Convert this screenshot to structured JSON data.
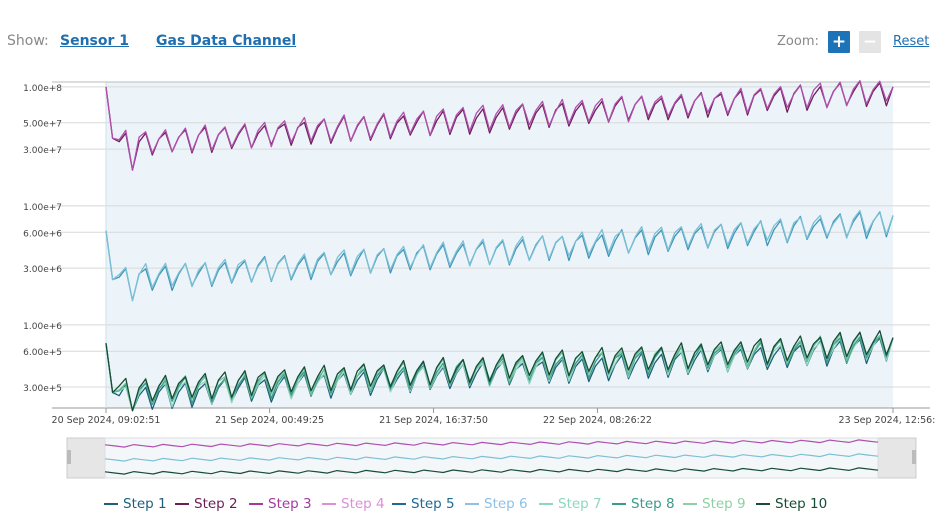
{
  "toolbar": {
    "show_label": "Show:",
    "sensor_link": "Sensor 1",
    "channel_link": "Gas Data Channel",
    "zoom_label": "Zoom:",
    "zoom_in": "+",
    "zoom_out": "−",
    "reset": "Reset"
  },
  "chart_data": {
    "type": "line",
    "yscale": "log",
    "grid": true,
    "ylim": [
      200000,
      110000000
    ],
    "y_ticks": [
      {
        "label": "1.00e+8",
        "value": 100000000
      },
      {
        "label": "5.00e+7",
        "value": 50000000
      },
      {
        "label": "3.00e+7",
        "value": 30000000
      },
      {
        "label": "1.00e+7",
        "value": 10000000
      },
      {
        "label": "6.00e+6",
        "value": 6000000
      },
      {
        "label": "3.00e+6",
        "value": 3000000
      },
      {
        "label": "1.00e+6",
        "value": 1000000
      },
      {
        "label": "6.00e+5",
        "value": 600000
      },
      {
        "label": "3.00e+5",
        "value": 300000
      }
    ],
    "x_range": [
      "2024-09-20T09:02:51",
      "2024-09-23T12:56:11"
    ],
    "x_ticks": [
      {
        "label": "20 Sep 2024, 09:02:51",
        "t": "2024-09-20T09:02:51"
      },
      {
        "label": "21 Sep 2024, 00:49:25",
        "t": "2024-09-21T00:49:25"
      },
      {
        "label": "21 Sep 2024, 16:37:50",
        "t": "2024-09-21T16:37:50"
      },
      {
        "label": "22 Sep 2024, 08:26:22",
        "t": "2024-09-22T08:26:22"
      },
      {
        "label": "23 Sep 2024, 12:56:11",
        "t": "2024-09-23T12:56:11"
      }
    ],
    "groups": [
      {
        "steps": [
          "Step 2",
          "Step 3"
        ],
        "start": 100000000,
        "first": 37000000,
        "low_dip": 20000000,
        "min_trend": 33000000,
        "max_trend": 95000000,
        "end": 100000000
      },
      {
        "steps": [
          "Step 5",
          "Step 6"
        ],
        "start": 6200000,
        "first": 2400000,
        "low_dip": 1600000,
        "min_trend": 2400000,
        "max_trend": 7500000,
        "end": 8300000
      },
      {
        "steps": [
          "Step 1",
          "Step 7",
          "Step 8",
          "Step 9",
          "Step 10"
        ],
        "start": 700000,
        "first": 270000,
        "low_dip": 190000,
        "min_trend": 260000,
        "max_trend": 680000,
        "end": 780000
      }
    ],
    "legend": [
      {
        "name": "Step 1",
        "color": "#1f5f7a"
      },
      {
        "name": "Step 2",
        "color": "#6b1f57"
      },
      {
        "name": "Step 3",
        "color": "#a23c9c"
      },
      {
        "name": "Step 4",
        "color": "#dd8fd9"
      },
      {
        "name": "Step 5",
        "color": "#1e6b93"
      },
      {
        "name": "Step 6",
        "color": "#8cc0e8"
      },
      {
        "name": "Step 7",
        "color": "#8fd6c0"
      },
      {
        "name": "Step 8",
        "color": "#3c9a8a"
      },
      {
        "name": "Step 9",
        "color": "#8dd0a4"
      },
      {
        "name": "Step 10",
        "color": "#174d35"
      }
    ],
    "series_colors": {
      "Step 2": "#6b1f57",
      "Step 3": "#b04fae",
      "Step 5": "#3e95b8",
      "Step 6": "#7cc0d6",
      "Step 1": "#1f5f7a",
      "Step 7": "#8fd6c0",
      "Step 8": "#3c9a8a",
      "Step 9": "#6dc29b",
      "Step 10": "#174d35"
    },
    "plot_bg": "#ecf4f9",
    "grid_color": "#d8d8d8"
  }
}
